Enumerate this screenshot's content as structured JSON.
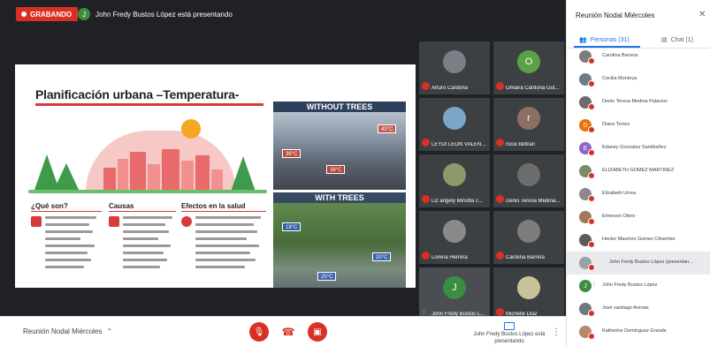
{
  "recording": {
    "label": "GRABANDO"
  },
  "banner": {
    "avatar": "J",
    "text": "John Fredy Bustos López está presentando"
  },
  "slide": {
    "title": "Planificación urbana –Temperatura-",
    "col1": "¿Qué son?",
    "col2": "Causas",
    "col3": "Efectos en la salud",
    "photo_top_label": "WITHOUT TREES",
    "photo_bottom_label": "WITH TREES",
    "temps_top": [
      "43°C",
      "36°C",
      "38°C"
    ],
    "temps_bottom": [
      "18°C",
      "20°C",
      "25°C"
    ]
  },
  "tiles": [
    {
      "name": "Arturo Cardona",
      "initial": "",
      "color": "#7a7f86"
    },
    {
      "name": "Omaira Cardona Gut...",
      "initial": "O",
      "color": "#5aa243"
    },
    {
      "name": "LEYDI LEÓN VALENC...",
      "initial": "",
      "color": "#7aa7c7"
    },
    {
      "name": "rocio beltran",
      "initial": "r",
      "color": "#8d6e63"
    },
    {
      "name": "Liz angely Minotta c...",
      "initial": "",
      "color": "#8a9a6b"
    },
    {
      "name": "Denis Teresa Medina...",
      "initial": "",
      "color": "#6c6c6c"
    },
    {
      "name": "Lorena Herrera",
      "initial": "",
      "color": "#8a8a8a"
    },
    {
      "name": "Carolina Barrera",
      "initial": "",
      "color": "#7c7c7c"
    },
    {
      "name": "John Fredy Bustos L...",
      "initial": "J",
      "color": "#3b8d3f"
    },
    {
      "name": "Michelle Diaz",
      "initial": "",
      "color": "#c8c29a"
    }
  ],
  "bottom": {
    "meeting_name": "Reunión Nodal Miércoles",
    "present_status": "John Fredy Bustos López está presentando"
  },
  "panel": {
    "title": "Reunión Nodal Miércoles",
    "people_tab": "Personas (31)",
    "chat_tab": "Chat (1)",
    "participants": [
      {
        "name": "Carolina Barrera",
        "initial": "",
        "color": "#7c7c7c"
      },
      {
        "name": "Cecilia Montoya",
        "initial": "",
        "color": "#6f7a86"
      },
      {
        "name": "Denis Teresa Medina Palacios",
        "initial": "",
        "color": "#6c6c6c"
      },
      {
        "name": "Diana Torres",
        "initial": "D",
        "color": "#e8710a"
      },
      {
        "name": "Edaney Gonzalez Santibañez",
        "initial": "E",
        "color": "#8e63ce"
      },
      {
        "name": "ELIZABETH GOMEZ MARTINEZ",
        "initial": "",
        "color": "#7d8a6a"
      },
      {
        "name": "Elizabeth Urrea",
        "initial": "",
        "color": "#8a8a8a"
      },
      {
        "name": "Emerson Otero",
        "initial": "",
        "color": "#a07a55"
      },
      {
        "name": "Hector Mauricio Gomez Cifuentes",
        "initial": "",
        "color": "#5d5d5d"
      },
      {
        "name": "John Fredy Bustos López (presentan...",
        "initial": "",
        "color": "#9aa0a6"
      },
      {
        "name": "John Fredy Bustos López",
        "initial": "J",
        "color": "#3b8d3f"
      },
      {
        "name": "José santiago Arenas",
        "initial": "",
        "color": "#6c7a80"
      },
      {
        "name": "Katherine Dominguez Grande",
        "initial": "",
        "color": "#b38a6e"
      }
    ]
  }
}
